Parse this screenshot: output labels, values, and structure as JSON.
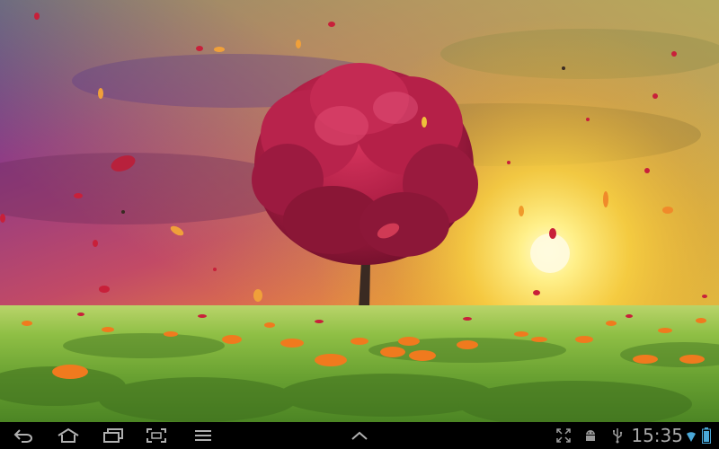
{
  "wallpaper": {
    "name": "autumn-tree-wallpaper",
    "colors": {
      "sky_top": "#3b3f9a",
      "sky_mid": "#b0427a",
      "sky_horizon": "#f3b03a",
      "sun": "#fff7b0",
      "tree_foliage": "#a8163c",
      "tree_highlight": "#d8345e",
      "trunk": "#3a2a22",
      "grass_light": "#9cc552",
      "grass_dark": "#3f6f1e",
      "leaf_orange": "#f07a1e",
      "leaf_red": "#c8203a"
    }
  },
  "navbar": {
    "buttons": [
      {
        "name": "back-button",
        "icon": "back-arrow-icon"
      },
      {
        "name": "home-button",
        "icon": "home-icon"
      },
      {
        "name": "recent-apps-button",
        "icon": "recent-apps-icon"
      },
      {
        "name": "screenshot-button",
        "icon": "screenshot-icon"
      },
      {
        "name": "menu-button",
        "icon": "menu-icon"
      },
      {
        "name": "app-drawer-chevron",
        "icon": "chevron-up-icon"
      }
    ],
    "status": {
      "icons": [
        "fullscreen-icon",
        "android-icon",
        "usb-icon",
        "wifi-icon",
        "battery-icon"
      ],
      "time": "15:35"
    }
  }
}
